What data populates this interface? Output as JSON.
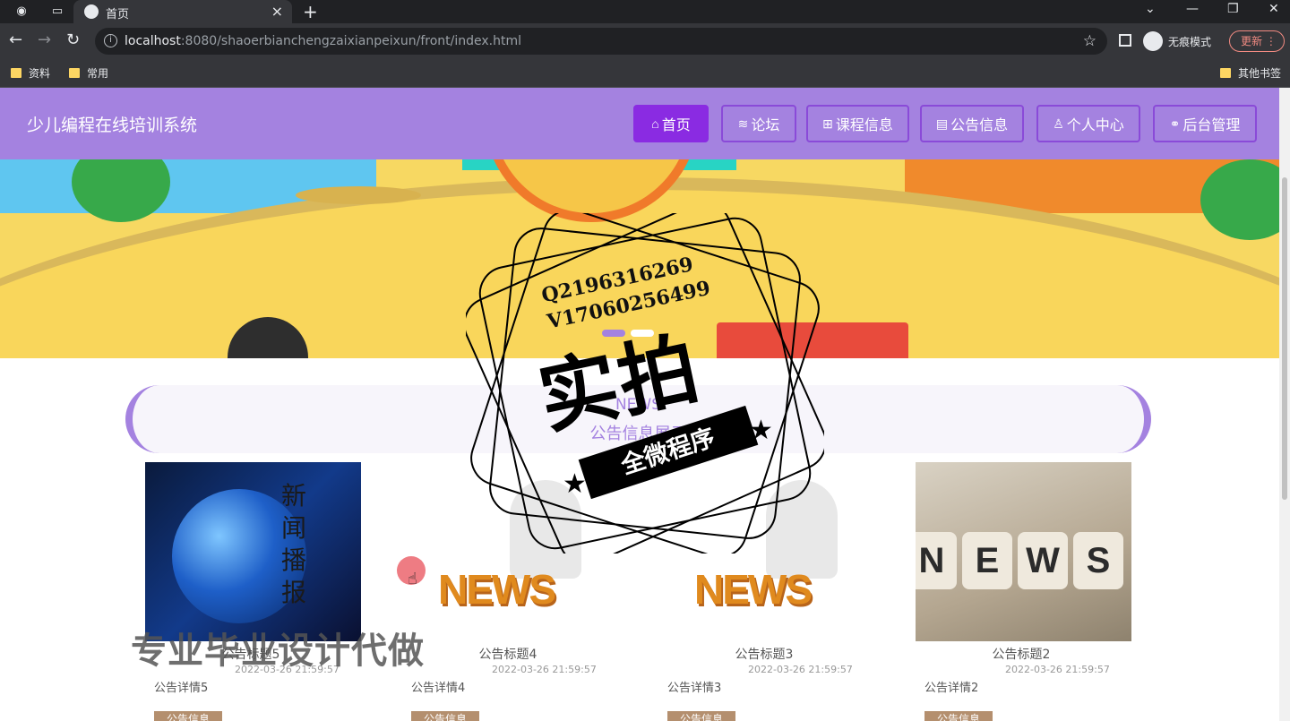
{
  "browser": {
    "tab_title": "首页",
    "url_host": "localhost",
    "url_path": ":8080/shaoerbianchengzaixianpeixun/front/index.html",
    "incognito_label": "无痕模式",
    "update_label": "更新",
    "bookmarks": [
      "资料",
      "常用"
    ],
    "other_bookmarks": "其他书签"
  },
  "header": {
    "site_title": "少儿编程在线培训系统",
    "nav": [
      {
        "label": "首页",
        "icon": "home-icon"
      },
      {
        "label": "论坛",
        "icon": "layers-icon"
      },
      {
        "label": "课程信息",
        "icon": "grid-icon"
      },
      {
        "label": "公告信息",
        "icon": "document-icon"
      },
      {
        "label": "个人中心",
        "icon": "user-icon"
      },
      {
        "label": "后台管理",
        "icon": "link-icon"
      }
    ],
    "active_color": "#8a2be2",
    "bar_color": "#a482e0"
  },
  "news_section": {
    "title_en": "NEWS",
    "title_cn": "公告信息展示"
  },
  "news_cards": [
    {
      "title": "公告标题5",
      "date": "2022-03-26 21:59:57",
      "detail": "公告详情5",
      "tag": "公告信息",
      "image_text": "新闻播报"
    },
    {
      "title": "公告标题4",
      "date": "2022-03-26 21:59:57",
      "detail": "公告详情4",
      "tag": "公告信息",
      "image_text": "NEWS"
    },
    {
      "title": "公告标题3",
      "date": "2022-03-26 21:59:57",
      "detail": "公告详情3",
      "tag": "公告信息",
      "image_text": "NEWS"
    },
    {
      "title": "公告标题2",
      "date": "2022-03-26 21:59:57",
      "detail": "公告详情2",
      "tag": "公告信息",
      "image_text": "NEWS"
    }
  ],
  "watermark": {
    "phone_q": "Q2196316269",
    "phone_v": "V17060256499",
    "big": "实拍",
    "ribbon": "全微程序",
    "bottom": "专业毕业设计代做"
  }
}
